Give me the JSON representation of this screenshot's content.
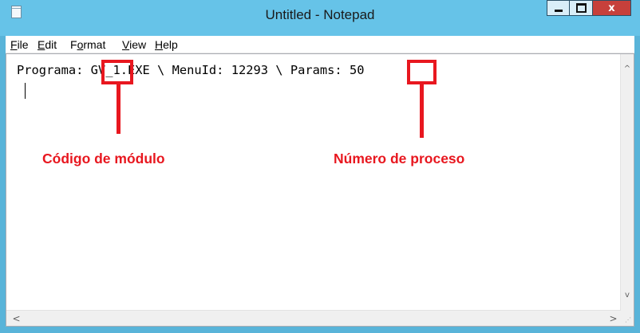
{
  "window": {
    "title": "Untitled - Notepad",
    "icons": {
      "app": "notepad-icon",
      "minimize": "minimize-icon",
      "maximize": "maximize-icon",
      "close": "close-icon"
    },
    "close_glyph": "x"
  },
  "menubar": {
    "items": [
      {
        "label": "File",
        "mnemonic": "F",
        "rest": "ile"
      },
      {
        "label": "Edit",
        "mnemonic": "E",
        "rest": "dit"
      },
      {
        "label": "Format",
        "mnemonic_pre": "F",
        "mnemonic": "o",
        "rest": "rmat"
      },
      {
        "label": "View",
        "mnemonic": "V",
        "rest": "iew"
      },
      {
        "label": "Help",
        "mnemonic": "H",
        "rest": "elp"
      }
    ]
  },
  "editor": {
    "text": "Programa: GV_1.EXE \\ MenuId: 12293 \\ Params: 50"
  },
  "scrollbars": {
    "vertical_up": "^",
    "vertical_down": "v",
    "horizontal_left": "<",
    "horizontal_right": ">",
    "icons": {
      "up": "chevron-up-icon",
      "down": "chevron-down-icon",
      "left": "chevron-left-icon",
      "right": "chevron-right-icon",
      "grip": "resize-grip-icon"
    }
  },
  "annotations": {
    "module_code_label": "Código de módulo",
    "process_number_label": "Número de proceso",
    "highlight_color": "#e8171f"
  },
  "colors": {
    "titlebar": "#66c3e8",
    "frame": "#59b4d9",
    "close_button": "#c7403b"
  }
}
